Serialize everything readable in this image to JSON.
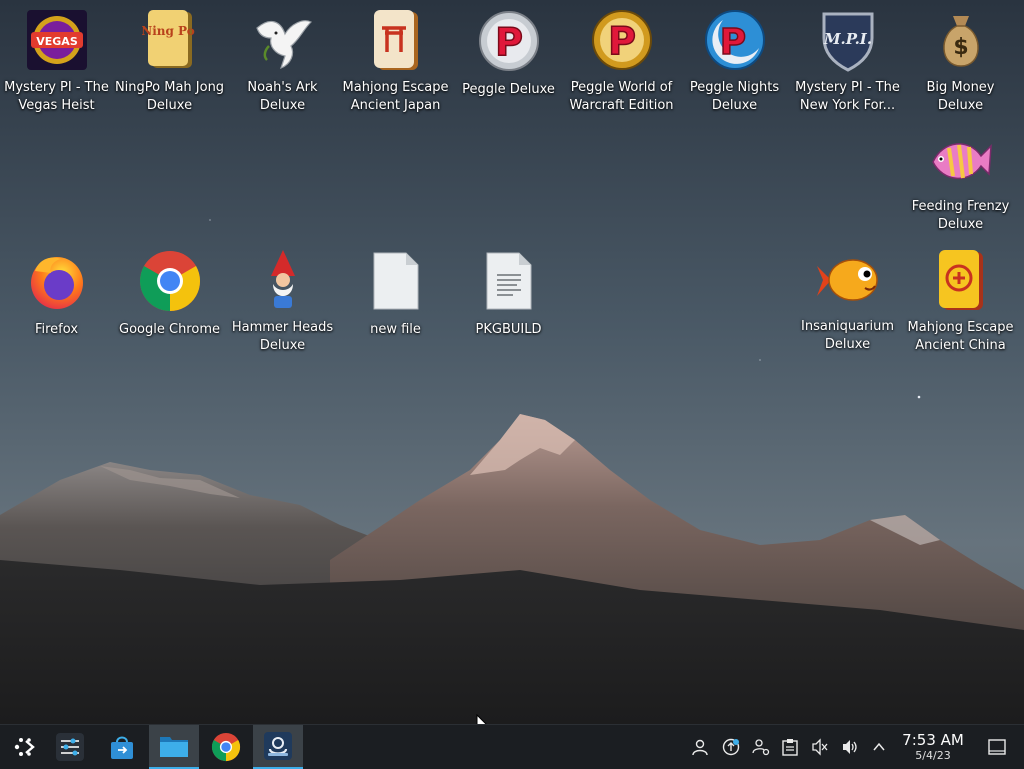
{
  "desktop": {
    "icons": [
      {
        "label": "Mystery PI - The Vegas Heist",
        "icon": "mystery-pi-vegas-icon"
      },
      {
        "label": "NingPo Mah Jong Deluxe",
        "icon": "ningpo-tile-icon",
        "art_text": "Ning Po"
      },
      {
        "label": "Noah's Ark Deluxe",
        "icon": "dove-icon"
      },
      {
        "label": "Mahjong Escape Ancient Japan",
        "icon": "mahjong-japan-tile-icon"
      },
      {
        "label": "Peggle Deluxe",
        "icon": "peggle-ball-icon",
        "art_text": "P"
      },
      {
        "label": "Peggle World of Warcraft Edition",
        "icon": "peggle-wow-icon",
        "art_text": "P"
      },
      {
        "label": "Peggle Nights Deluxe",
        "icon": "peggle-nights-icon",
        "art_text": "P"
      },
      {
        "label": "Mystery PI - The New York For...",
        "icon": "mystery-pi-ny-shield-icon",
        "art_text": "M.P.I."
      },
      {
        "label": "Big Money Deluxe",
        "icon": "money-bag-icon",
        "art_text": "$"
      },
      {
        "label": "Feeding Frenzy Deluxe",
        "icon": "tropical-fish-icon"
      },
      {
        "label": "Firefox",
        "icon": "firefox-icon"
      },
      {
        "label": "Google Chrome",
        "icon": "chrome-icon"
      },
      {
        "label": "Hammer Heads Deluxe",
        "icon": "gnome-icon"
      },
      {
        "label": "new file",
        "icon": "blank-file-icon"
      },
      {
        "label": "PKGBUILD",
        "icon": "text-file-icon"
      },
      {
        "label": "Insaniquarium Deluxe",
        "icon": "goldfish-icon"
      },
      {
        "label": "Mahjong Escape Ancient China",
        "icon": "mahjong-china-tile-icon"
      }
    ],
    "vegas_art_text": "VEGAS"
  },
  "taskbar": {
    "items": [
      {
        "name": "application-launcher",
        "icon": "steam-deck-launcher-icon"
      },
      {
        "name": "system-settings",
        "icon": "settings-sliders-icon"
      },
      {
        "name": "discover-store",
        "icon": "shopping-bag-icon"
      },
      {
        "name": "dolphin-file-manager",
        "icon": "folder-icon"
      },
      {
        "name": "google-chrome",
        "icon": "chrome-icon"
      },
      {
        "name": "steam-return",
        "icon": "steam-return-icon"
      }
    ],
    "tray": [
      {
        "name": "user",
        "icon": "user-icon"
      },
      {
        "name": "updates",
        "icon": "update-icon"
      },
      {
        "name": "accounts",
        "icon": "user-settings-icon"
      },
      {
        "name": "clipboard",
        "icon": "clipboard-icon"
      },
      {
        "name": "mic-muted",
        "icon": "speaker-muted-icon"
      },
      {
        "name": "volume",
        "icon": "volume-icon"
      },
      {
        "name": "expand-tray",
        "icon": "chevron-up-icon"
      }
    ],
    "clock": {
      "time": "7:53 AM",
      "date": "5/4/23"
    }
  },
  "colors": {
    "accent": "#3daee9",
    "taskbar": "#1b1e22"
  }
}
